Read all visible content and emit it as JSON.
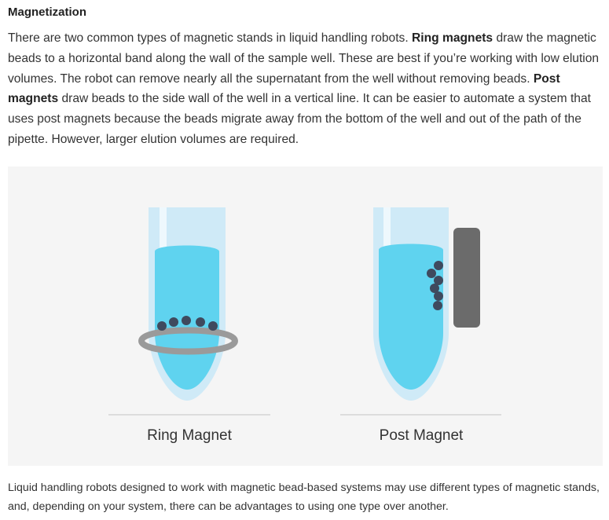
{
  "section": {
    "heading": "Magnetization"
  },
  "intro": {
    "part1": "There are two common types of magnetic stands in liquid handling robots. ",
    "ring_term": "Ring magnets",
    "part2": " draw the magnetic beads to a horizontal band along the wall of the sample well. These are best if you’re working with low elution volumes. The robot can remove nearly all the supernatant from the well without removing beads. ",
    "post_term": "Post magnets",
    "part3": " draw beads to the side wall of the well in a vertical line. It can be easier to automate a system that uses post magnets because the beads migrate away from the bottom of the well and out of the path of the pipette. However, larger elution volumes are required."
  },
  "figure": {
    "ring_label": "Ring Magnet",
    "post_label": "Post Magnet",
    "colors": {
      "background": "#f5f5f5",
      "tube": "#cfeaf7",
      "tube_highlight": "#eef8fd",
      "liquid": "#5fd3ef",
      "bead": "#3f4a5e",
      "magnet": "#6b6b6b",
      "ring": "#9a9a9a",
      "baseline": "#d3d3d3"
    }
  },
  "caption": {
    "text": "Liquid handling robots designed to work with magnetic bead-based systems may use different types of magnetic stands, and, depending on your system, there can be advantages to using one type over another."
  }
}
